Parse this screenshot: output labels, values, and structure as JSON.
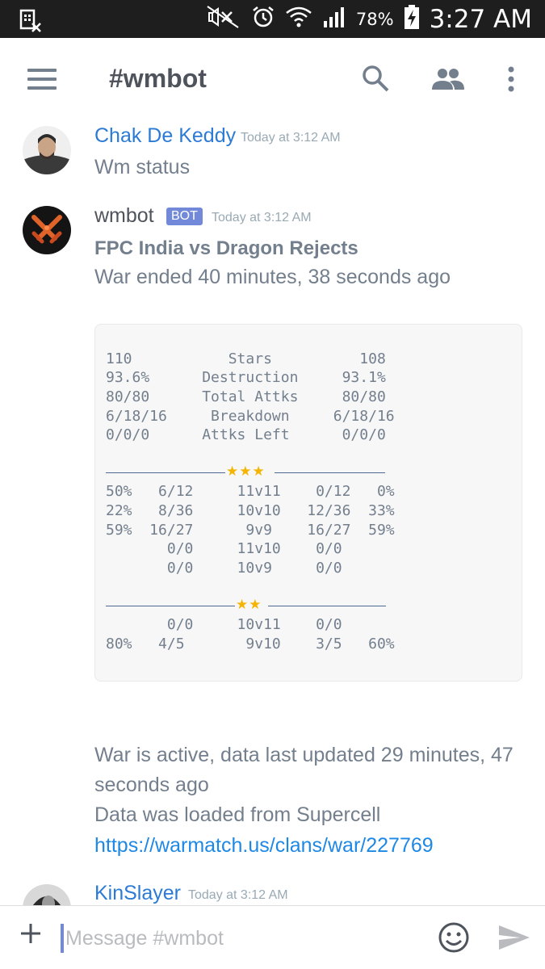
{
  "status_bar": {
    "battery_percent": "78%",
    "time": "3:27 AM",
    "icons": [
      "no-sim-icon",
      "mute-icon",
      "alarm-icon",
      "wifi-icon",
      "signal-icon",
      "battery-charging-icon"
    ]
  },
  "header": {
    "channel": "#wmbot",
    "icons": [
      "menu-icon",
      "search-icon",
      "members-icon",
      "more-icon"
    ]
  },
  "messages": [
    {
      "author": "Chak De Keddy",
      "timestamp": "Today at 3:12 AM",
      "text": "Wm status"
    },
    {
      "author": "wmbot",
      "bot_tag": "BOT",
      "timestamp": "Today at 3:12 AM",
      "title": "FPC India vs Dragon Rejects",
      "subtitle": "War ended 40 minutes, 38 seconds ago",
      "code_lines": [
        "110           Stars          108",
        "93.6%      Destruction     93.1%",
        "80/80      Total Attks     80/80",
        "6/18/16     Breakdown     6/18/16",
        "0/0/0      Attks Left      0/0/0"
      ],
      "three_star_label": "★★★",
      "three_star_rows": [
        "50%   6/12     11v11    0/12   0%",
        "22%   8/36     10v10   12/36  33%",
        "59%  16/27      9v9    16/27  59%",
        "       0/0     11v10    0/0",
        "       0/0     10v9     0/0"
      ],
      "two_star_label": "★★",
      "two_star_rows": [
        "       0/0     10v11    0/0",
        "80%   4/5       9v10    3/5   60%"
      ],
      "footer_line1": "War is active, data last updated 29 minutes, 47",
      "footer_line2": "seconds ago",
      "footer_line3": "Data was loaded from Supercell",
      "link": "https://warmatch.us/clans/war/227769"
    },
    {
      "author": "KinSlayer",
      "timestamp": "Today at 3:12 AM"
    }
  ],
  "composer": {
    "placeholder": "Message #wmbot",
    "icons": [
      "plus-icon",
      "emoji-icon",
      "send-icon"
    ]
  },
  "colors": {
    "accent": "#7289da",
    "link": "#1e88e5",
    "author_link": "#2b7bd6",
    "text": "#737f8d",
    "star": "#f5b400"
  }
}
